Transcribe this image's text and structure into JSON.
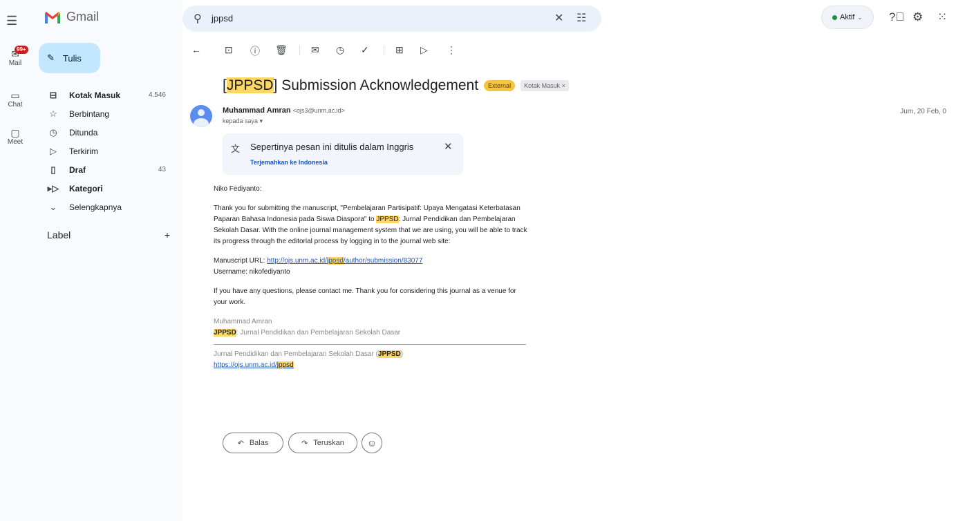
{
  "rail": {
    "badge": "99+",
    "items": [
      {
        "label": "Mail",
        "icon": "mail-icon"
      },
      {
        "label": "Chat",
        "icon": "chat-icon"
      },
      {
        "label": "Meet",
        "icon": "meet-icon"
      }
    ]
  },
  "app": {
    "name": "Gmail"
  },
  "compose": {
    "label": "Tulis"
  },
  "sidebar": {
    "items": [
      {
        "label": "Kotak Masuk",
        "count": "4.546"
      },
      {
        "label": "Berbintang",
        "count": ""
      },
      {
        "label": "Ditunda",
        "count": ""
      },
      {
        "label": "Terkirim",
        "count": ""
      },
      {
        "label": "Draf",
        "count": "43"
      },
      {
        "label": "Kategori",
        "count": ""
      },
      {
        "label": "Selengkapnya",
        "count": ""
      }
    ],
    "label_header": "Label",
    "label_add": "+"
  },
  "search": {
    "value": "jppsd"
  },
  "status": {
    "label": "Aktif",
    "color": "#1e8e3e"
  },
  "email": {
    "subject_highlight": "JPPSD",
    "subject_rest": " Submission Acknowledgement",
    "subject_open": "[",
    "subject_close": "]",
    "tag_external": "External",
    "tag_inbox": "Kotak Masuk ×",
    "sender_name": "Muhammad Amran",
    "sender_email": "<ojs3@unm.ac.id>",
    "to": "kepada saya ▾",
    "date": "Jum, 20 Feb, 0",
    "translate_text": "Sepertinya pesan ini ditulis dalam Inggris",
    "translate_link": "Terjemahkan ke Indonesia",
    "greeting": "Niko Fediyanto:",
    "body_p1_a": "Thank you for submitting the manuscript, \"Pembelajaran Partisipatif: Upaya Mengatasi Keterbatasan  Paparan Bahasa Indonesia pada Siswa Diaspora\" to ",
    "body_p1_hl": "JPPSD",
    "body_p1_b": ": Jurnal Pendidikan dan Pembelajaran Sekolah Dasar. With the online journal management system that we are using, you will be able to track its progress through the editorial process by logging in to the journal web site:",
    "url_label": "Manuscript URL: ",
    "url_a": "http://ojs.unm.ac.id/",
    "url_hl": "jppsd",
    "url_b": "/author/submission/83077",
    "username": "Username: nikofediyanto",
    "body_p3": "If you have any questions, please contact me. Thank you for considering this journal as a venue for your work.",
    "sig_name": "Muhammad Amran",
    "sig_hl": "JPPSD",
    "sig_rest": ": Jurnal Pendidikan dan Pembelajaran Sekolah Dasar",
    "footer_a": "Jurnal Pendidikan dan Pembelajaran Sekolah Dasar (",
    "footer_hl": "JPPSD",
    "footer_b": ")",
    "footer_link_a": "https://ojs.unm.ac.id/",
    "footer_link_hl": "jppsd"
  },
  "actions": {
    "reply": "Balas",
    "forward": "Teruskan"
  }
}
